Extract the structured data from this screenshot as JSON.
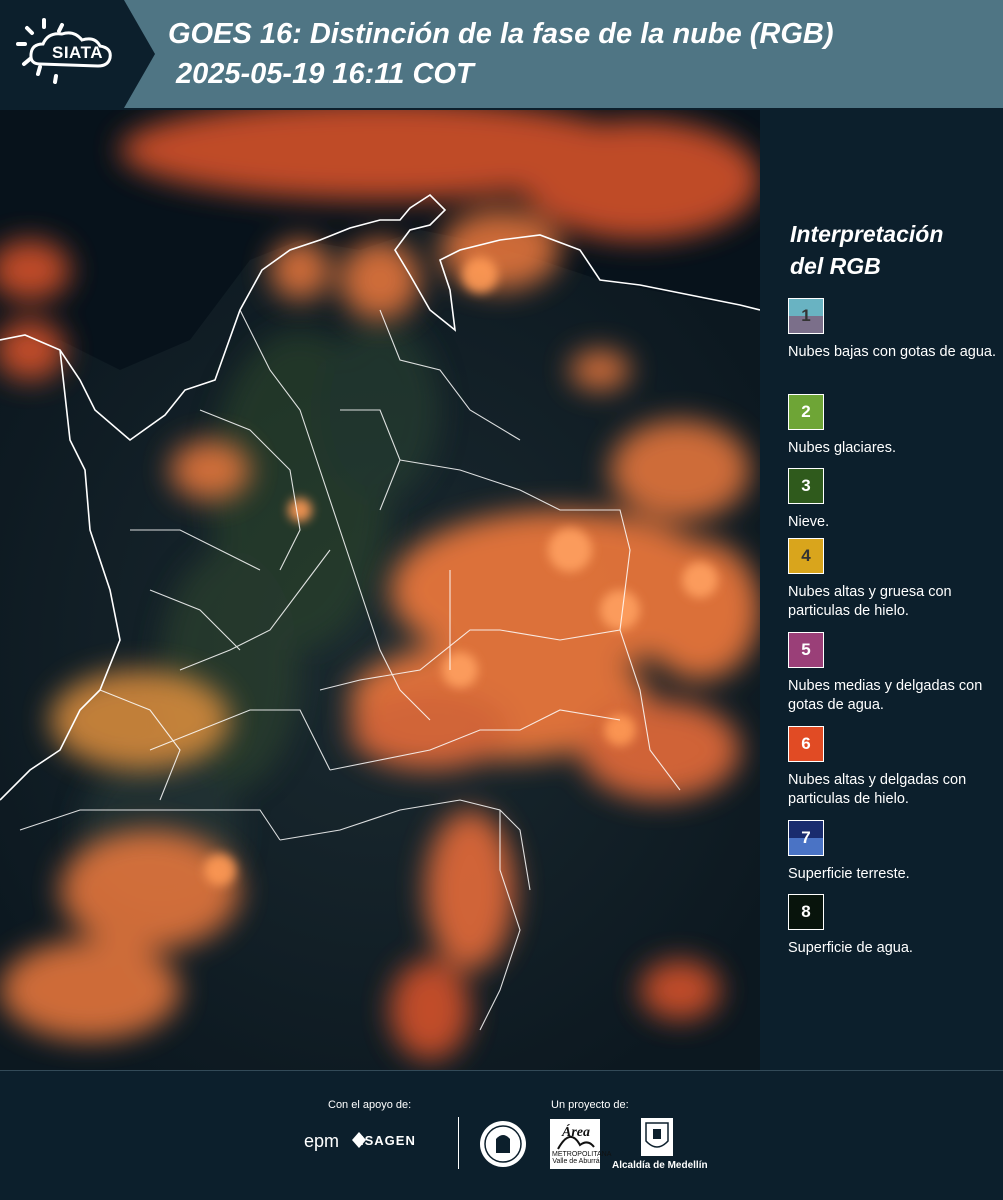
{
  "header": {
    "logo": "SIATA",
    "title": "GOES 16: Distinción de la fase de la nube (RGB)",
    "subtitle": "2025-05-19 16:11 COT"
  },
  "legend": {
    "title_line1": "Interpretación",
    "title_line2": "del RGB",
    "items": [
      {
        "number": "1",
        "label": "Nubes bajas con gotas de agua.",
        "color_top": "#69b3c2",
        "color_bottom": "#7b6f8a"
      },
      {
        "number": "2",
        "label": "Nubes glaciares.",
        "color_top": "#6ea536",
        "color_bottom": "#6ea536"
      },
      {
        "number": "3",
        "label": "Nieve.",
        "color_top": "#2f5a1c",
        "color_bottom": "#2f5a1c"
      },
      {
        "number": "4",
        "label": "Nubes altas y gruesa con particulas de hielo.",
        "color_top": "#d9a51c",
        "color_bottom": "#d9a51c"
      },
      {
        "number": "5",
        "label": "Nubes medias y delgadas con gotas de agua.",
        "color_top": "#9a3f78",
        "color_bottom": "#9a3f78"
      },
      {
        "number": "6",
        "label": "Nubes altas y delgadas con particulas de hielo.",
        "color_top": "#e14b24",
        "color_bottom": "#e14b24"
      },
      {
        "number": "7",
        "label": "Superficie terreste.",
        "color_top": "#1a2c6e",
        "color_bottom": "#4a73c5"
      },
      {
        "number": "8",
        "label": "Superficie de agua.",
        "color_top": "#08140c",
        "color_bottom": "#08140c"
      }
    ]
  },
  "footer": {
    "support_label": "Con el apoyo de:",
    "project_label": "Un proyecto de:",
    "epm": "epm",
    "isagen": "ISAGEN",
    "area_metropolitana": "METROPOLITANA Valle de Aburrá",
    "area_logo_word": "Área",
    "alcaldia": "Alcaldía de Medellín"
  },
  "colors": {
    "header_bg": "#4f7584",
    "logo_tab_bg": "#0c1f2c",
    "page_bg": "#0c1f2c",
    "cloud_orange": "#ff7a3a"
  }
}
